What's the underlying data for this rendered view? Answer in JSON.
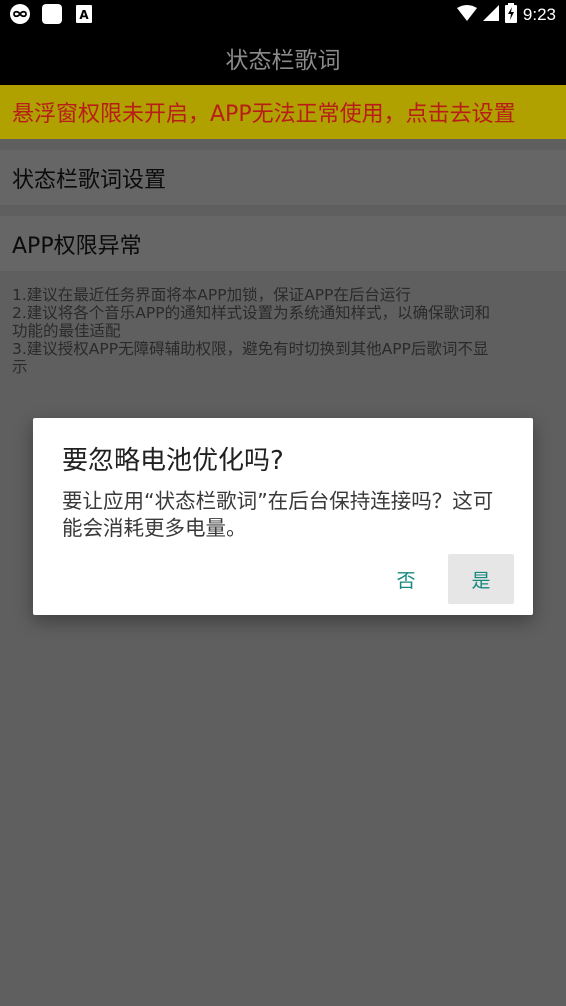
{
  "status_bar": {
    "left_icons": [
      "infinity-icon",
      "square-icon",
      "text-a-icon"
    ],
    "right_icons": [
      "wifi-icon",
      "signal-icon",
      "battery-charging-icon"
    ],
    "time": "9:23"
  },
  "app": {
    "title": "状态栏歌词"
  },
  "warning_banner": {
    "text": "悬浮窗权限未开启，APP无法正常使用，点击去设置",
    "bg_color": "#b0a100",
    "text_color": "#b81d18"
  },
  "sections": [
    {
      "label": "状态栏歌词设置"
    },
    {
      "label": "APP权限异常"
    }
  ],
  "notes": {
    "lines": [
      "1.建议在最近任务界面将本APP加锁，保证APP在后台运行",
      "2.建议将各个音乐APP的通知样式设置为系统通知样式，以确保歌词和",
      "功能的最佳适配",
      "3.建议授权APP无障碍辅助权限，避免有时切换到其他APP后歌词不显",
      "示"
    ]
  },
  "dialog": {
    "title": "要忽略电池优化吗?",
    "message": "要让应用“状态栏歌词”在后台保持连接吗？这可能会消耗更多电量。",
    "buttons": {
      "no": "否",
      "yes": "是"
    },
    "accent_color": "#16897f"
  }
}
